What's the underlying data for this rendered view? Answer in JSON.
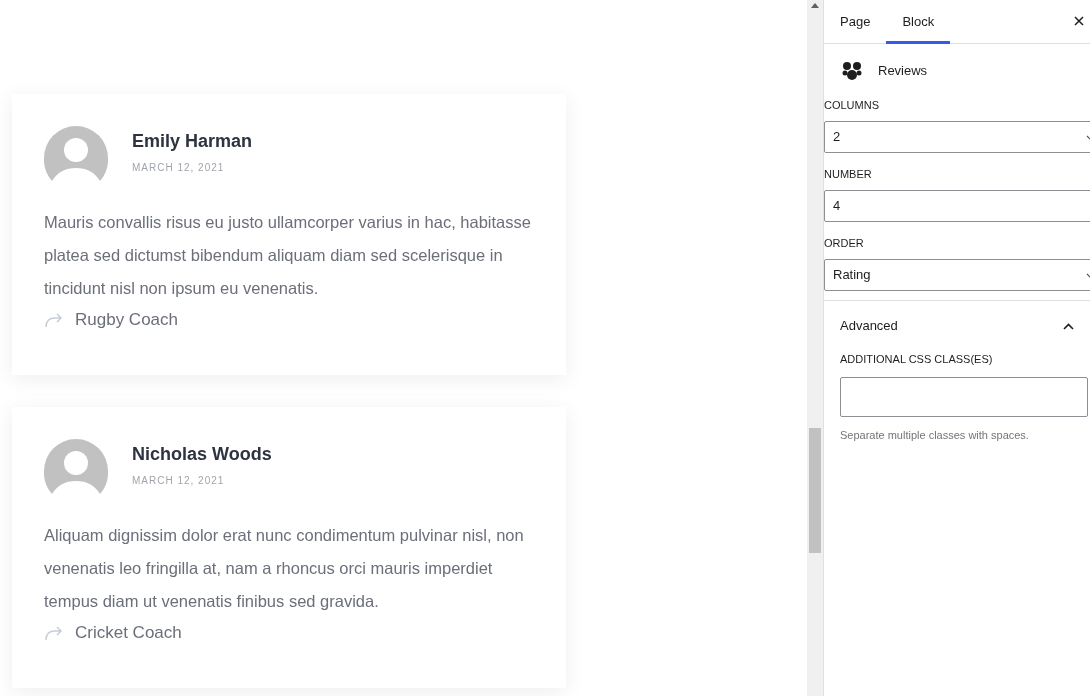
{
  "reviews": [
    {
      "name": "Emily Harman",
      "date": "MARCH 12, 2021",
      "text": "Mauris convallis risus eu justo ullamcorper varius in hac, habitasse platea sed dictumst bibendum aliquam diam sed scelerisque in tincidunt nisl non ipsum eu venenatis.",
      "role": "Rugby Coach"
    },
    {
      "name": "Nicholas Woods",
      "date": "MARCH 12, 2021",
      "text": "Aliquam dignissim dolor erat nunc condimentum pulvinar nisl, non venenatis leo fringilla at, nam a rhoncus orci mauris imperdiet tempus diam ut venenatis finibus sed gravida.",
      "role": "Cricket Coach"
    }
  ],
  "sidebar": {
    "tabs": [
      {
        "label": "Page",
        "selected": false
      },
      {
        "label": "Block",
        "selected": true
      }
    ],
    "block_title": "Reviews",
    "settings": [
      {
        "kind": "select",
        "label": "COLUMNS",
        "value": "2"
      },
      {
        "kind": "input",
        "label": "NUMBER",
        "value": "4"
      },
      {
        "kind": "select",
        "label": "ORDER",
        "value": "Rating"
      }
    ],
    "advanced": {
      "title": "Advanced",
      "expanded": true,
      "field_label": "ADDITIONAL CSS CLASS(ES)",
      "help": "Separate multiple classes with spaces."
    }
  }
}
